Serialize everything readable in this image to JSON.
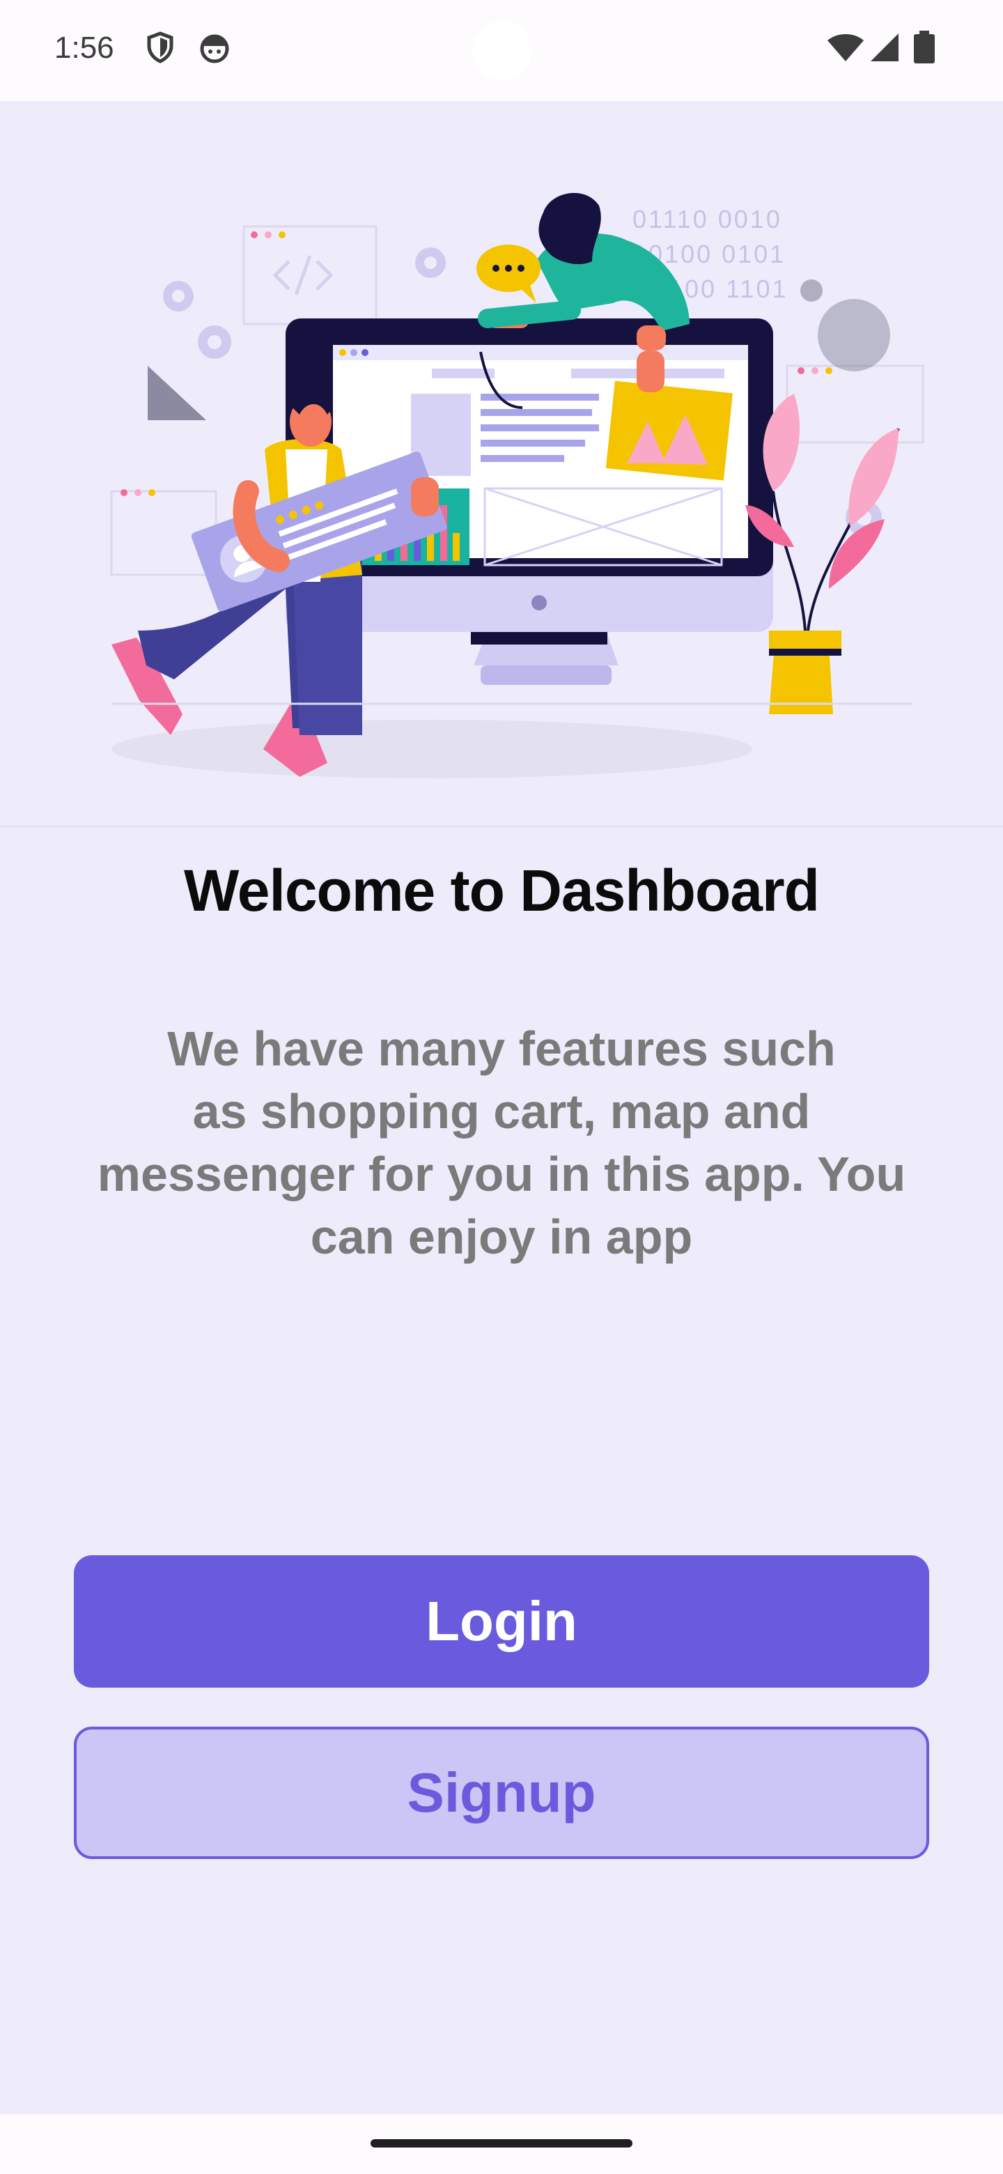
{
  "status_bar": {
    "time": "1:56",
    "icons": [
      "shield-icon",
      "android-face-icon",
      "wifi-icon",
      "signal-icon",
      "battery-icon"
    ]
  },
  "hero": {
    "binary_lines": [
      "01110 0010",
      "10100 0101",
      "100 1101"
    ]
  },
  "welcome": {
    "title": "Welcome to Dashboard",
    "lines": [
      "We have many features such",
      "as shopping cart, map and",
      "messenger for you in this app. You",
      "can enjoy in app"
    ]
  },
  "buttons": {
    "login_label": "Login",
    "signup_label": "Signup"
  },
  "colors": {
    "background": "#eeecfa",
    "primary": "#6a5add",
    "secondary_fill": "#cbc6f6",
    "subtitle_text": "#7a7a7a"
  }
}
